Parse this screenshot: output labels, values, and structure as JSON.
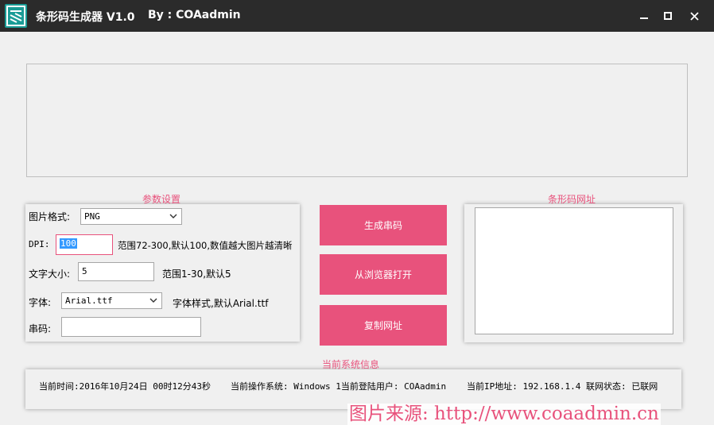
{
  "window": {
    "title": "条形码生成器 V1.0",
    "author": "By : COAadmin",
    "icon": "barcode-app-icon",
    "controls": [
      "minimize-icon",
      "maximize-icon",
      "close-icon"
    ]
  },
  "params": {
    "group_title": "参数设置",
    "format_label": "图片格式:",
    "format_value": "PNG",
    "dpi_label": "DPI:",
    "dpi_value": "100",
    "dpi_hint": "范围72-300,默认100,数值越大图片越清晰",
    "fontsize_label": "文字大小:",
    "fontsize_value": "5",
    "fontsize_hint": "范围1-30,默认5",
    "font_label": "字体:",
    "font_value": "Arial.ttf",
    "font_hint": "字体样式,默认Arial.ttf",
    "code_label": "串码:",
    "code_value": ""
  },
  "actions": {
    "generate": "生成串码",
    "open_browser": "从浏览器打开",
    "copy_url": "复制网址"
  },
  "url": {
    "group_title": "条形码网址",
    "value": ""
  },
  "sysinfo": {
    "group_title": "当前系统信息",
    "time": "当前时间:2016年10月24日 00时12分43秒",
    "os_user": "当前操作系统: Windows 1当前登陆用户: COAadmin",
    "ip_status": "当前IP地址: 192.168.1.4  联网状态: 已联网"
  },
  "watermark": "图片来源: http://www.coaadmin.cn",
  "colors": {
    "titlebar": "#2b2b2b",
    "accent": "#e8527c",
    "icon_bg": "#1a9c96",
    "background": "#f0f0f0"
  }
}
